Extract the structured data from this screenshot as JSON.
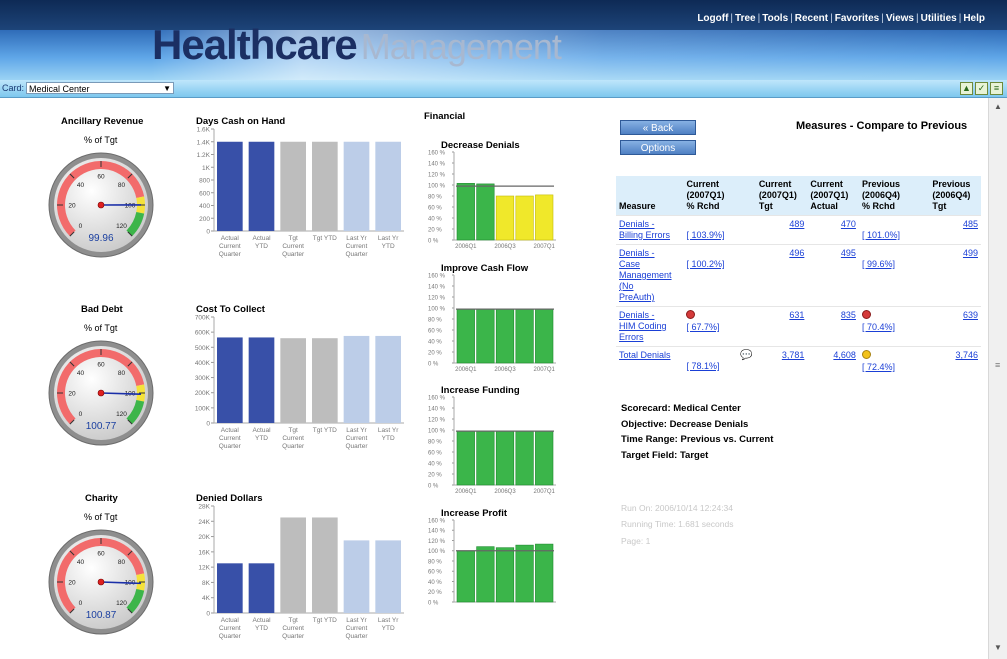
{
  "header": {
    "links": [
      "Logoff",
      "Tree",
      "Tools",
      "Recent",
      "Favorites",
      "Views",
      "Utilities",
      "Help"
    ],
    "logo_main": "Healthcare",
    "logo_sub": "Management"
  },
  "cardbar": {
    "label": "Card:",
    "selected": "Medical Center"
  },
  "colors": {
    "dark_blue_bar": "#3850a8",
    "grey_bar": "#bdbdbd",
    "light_blue_bar": "#bccde8",
    "green_bar": "#3bb54a",
    "yellow_bar": "#f0e82a",
    "target_line": "#666666"
  },
  "gauges": [
    {
      "title": "Ancillary Revenue",
      "subtitle": "% of Tgt",
      "value": "99.96",
      "needle": 99.96
    },
    {
      "title": "Bad Debt",
      "subtitle": "% of Tgt",
      "value": "100.77",
      "needle": 100.77
    },
    {
      "title": "Charity",
      "subtitle": "% of Tgt",
      "value": "100.87",
      "needle": 100.87
    }
  ],
  "gauge_ticks": [
    "0",
    "20",
    "40",
    "60",
    "80",
    "100",
    "120"
  ],
  "financial_label": "Financial",
  "chart_data": [
    {
      "type": "bar",
      "title": "Days Cash on Hand",
      "categories": [
        "Actual Current Quarter",
        "Actual YTD",
        "Tgt Current Quarter",
        "Tgt YTD",
        "Last Yr Current Quarter",
        "Last Yr YTD"
      ],
      "values": [
        1.4,
        1.4,
        1.4,
        1.4,
        1.4,
        1.4
      ],
      "yticks": [
        "1.6K",
        "1.4K",
        "1.2K",
        "1K",
        "800",
        "600",
        "400",
        "200",
        "0"
      ],
      "ylim": [
        0,
        1.6
      ]
    },
    {
      "type": "bar",
      "title": "Cost To Collect",
      "categories": [
        "Actual Current Quarter",
        "Actual YTD",
        "Tgt Current Quarter",
        "Tgt YTD",
        "Last Yr Current Quarter",
        "Last Yr YTD"
      ],
      "values": [
        565,
        565,
        560,
        560,
        575,
        575
      ],
      "yticks": [
        "700K",
        "600K",
        "500K",
        "400K",
        "300K",
        "200K",
        "100K",
        "0"
      ],
      "ylim": [
        0,
        700
      ]
    },
    {
      "type": "bar",
      "title": "Denied Dollars",
      "categories": [
        "Actual Current Quarter",
        "Actual YTD",
        "Tgt Current Quarter",
        "Tgt YTD",
        "Last Yr Current Quarter",
        "Last Yr YTD"
      ],
      "values": [
        13,
        13,
        25,
        25,
        19,
        19
      ],
      "yticks": [
        "28K",
        "24K",
        "20K",
        "16K",
        "12K",
        "8K",
        "4K",
        "0"
      ],
      "ylim": [
        0,
        28
      ]
    },
    {
      "type": "bar",
      "title": "Decrease Denials",
      "categories": [
        "2006Q1",
        "2006Q2",
        "2006Q3",
        "2006Q4",
        "2007Q1"
      ],
      "values": [
        103,
        102,
        80,
        80,
        82
      ],
      "target": [
        98,
        98,
        98,
        98,
        98
      ],
      "colors": [
        "green",
        "green",
        "yellow",
        "yellow",
        "yellow"
      ],
      "yticks": [
        "160 %",
        "140 %",
        "120 %",
        "100 %",
        "80 %",
        "60 %",
        "40 %",
        "20 %",
        "0 %"
      ],
      "xticks": [
        "2006Q1",
        "2006Q3",
        "2007Q1"
      ],
      "ylim": [
        0,
        160
      ]
    },
    {
      "type": "bar",
      "title": "Improve Cash Flow",
      "categories": [
        "2006Q1",
        "2006Q2",
        "2006Q3",
        "2006Q4",
        "2007Q1"
      ],
      "values": [
        98,
        98,
        98,
        98,
        98
      ],
      "target": [
        98,
        98,
        98,
        98,
        98
      ],
      "colors": [
        "green",
        "green",
        "green",
        "green",
        "green"
      ],
      "yticks": [
        "160 %",
        "140 %",
        "120 %",
        "100 %",
        "80 %",
        "60 %",
        "40 %",
        "20 %",
        "0 %"
      ],
      "xticks": [
        "2006Q1",
        "2006Q3",
        "2007Q1"
      ],
      "ylim": [
        0,
        160
      ]
    },
    {
      "type": "bar",
      "title": "Increase Funding",
      "categories": [
        "2006Q1",
        "2006Q2",
        "2006Q3",
        "2006Q4",
        "2007Q1"
      ],
      "values": [
        98,
        98,
        98,
        98,
        98
      ],
      "target": [
        98,
        98,
        98,
        98,
        98
      ],
      "colors": [
        "green",
        "green",
        "green",
        "green",
        "green"
      ],
      "yticks": [
        "160 %",
        "140 %",
        "120 %",
        "100 %",
        "80 %",
        "60 %",
        "40 %",
        "20 %",
        "0 %"
      ],
      "xticks": [
        "2006Q1",
        "2006Q3",
        "2007Q1"
      ],
      "ylim": [
        0,
        160
      ]
    },
    {
      "type": "bar",
      "title": "Increase Profit",
      "categories": [
        "2006Q1",
        "2006Q2",
        "2006Q3",
        "2006Q4",
        "2007Q1"
      ],
      "values": [
        100,
        108,
        106,
        111,
        113
      ],
      "target": [
        100,
        100,
        100,
        100,
        100
      ],
      "colors": [
        "green",
        "green",
        "green",
        "green",
        "green"
      ],
      "yticks": [
        "160 %",
        "140 %",
        "120 %",
        "100 %",
        "80 %",
        "60 %",
        "40 %",
        "20 %",
        "0 %"
      ],
      "xticks": [],
      "ylim": [
        0,
        160
      ]
    }
  ],
  "panel": {
    "back": "« Back",
    "options": "Options",
    "title": "Measures - Compare to Previous",
    "headers": [
      [
        "Measure"
      ],
      [
        "Current",
        "(2007Q1)",
        "% Rchd"
      ],
      [
        "Current",
        "(2007Q1)",
        "Tgt"
      ],
      [
        "Current",
        "(2007Q1)",
        "Actual"
      ],
      [
        "Previous",
        "(2006Q4)",
        "% Rchd"
      ],
      [
        "Previous",
        "(2006Q4)",
        "Tgt"
      ]
    ],
    "rows": [
      {
        "measure": [
          "Denials -",
          "Billing Errors"
        ],
        "cur_rchd": "[ 103.9%]",
        "cur_dot": "",
        "cur_tgt": "489",
        "cur_act": "470",
        "prev_rchd": "[ 101.0%]",
        "prev_dot": "",
        "prev_tgt": "485"
      },
      {
        "measure": [
          "Denials -",
          "Case",
          "Management",
          "(No",
          "PreAuth)"
        ],
        "cur_rchd": "[ 100.2%]",
        "cur_dot": "",
        "cur_tgt": "496",
        "cur_act": "495",
        "prev_rchd": "[ 99.6%]",
        "prev_dot": "",
        "prev_tgt": "499"
      },
      {
        "measure": [
          "Denials -",
          "HIM Coding",
          "Errors"
        ],
        "cur_rchd": "[ 67.7%]",
        "cur_dot": "red",
        "cur_tgt": "631",
        "cur_act": "835",
        "prev_rchd": "[ 70.4%]",
        "prev_dot": "red",
        "prev_tgt": "639"
      },
      {
        "measure": [
          "Total Denials"
        ],
        "cur_rchd": "[ 78.1%]",
        "cur_dot": "",
        "cur_tgt": "3,781",
        "cur_act": "4,608",
        "prev_rchd": "[ 72.4%]",
        "prev_dot": "yellow",
        "prev_tgt": "3,746"
      }
    ],
    "scorecard": "Scorecard: Medical Center",
    "objective": "Objective: Decrease Denials",
    "time_range": "Time Range: Previous vs. Current",
    "target_field": "Target Field: Target",
    "run_on": "Run On: 2006/10/14 12:24:34",
    "running_time": "Running Time: 1.681 seconds",
    "page": "Page: 1"
  }
}
